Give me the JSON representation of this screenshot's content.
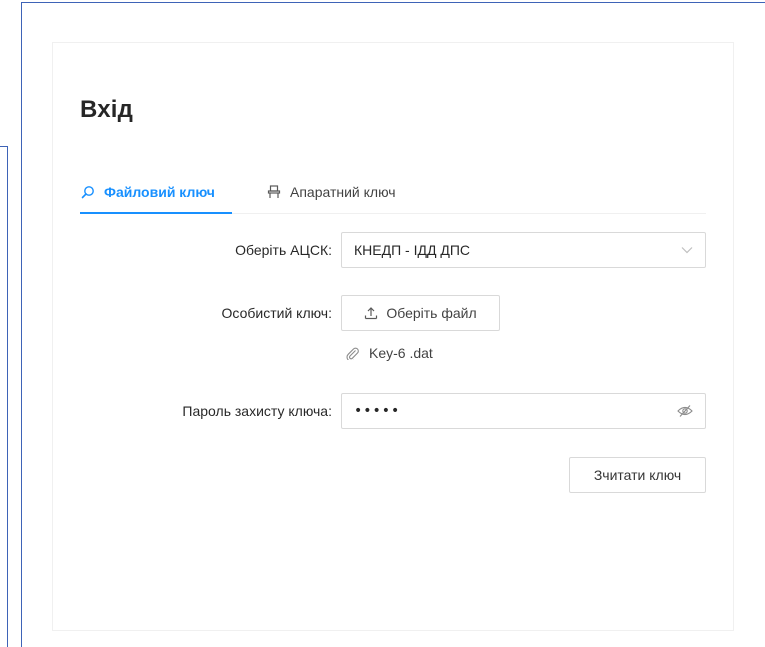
{
  "login": {
    "title": "Вхід",
    "tabs": [
      {
        "label": "Файловий ключ",
        "icon": "search-icon",
        "active": true
      },
      {
        "label": "Апаратний ключ",
        "icon": "usb-key-icon",
        "active": false
      }
    ],
    "form": {
      "ca_label": "Оберіть АЦСК:",
      "ca_value": "КНЕДП - ІДД ДПС",
      "key_label": "Особистий ключ:",
      "upload_label": "Оберіть файл",
      "file_name": "Key-6 .dat",
      "password_label": "Пароль захисту ключа:",
      "password_mask": "•••••",
      "submit_label": "Зчитати ключ"
    },
    "colors": {
      "accent": "#1890ff",
      "frame": "#3e63b7",
      "border": "#d9d9d9"
    }
  }
}
